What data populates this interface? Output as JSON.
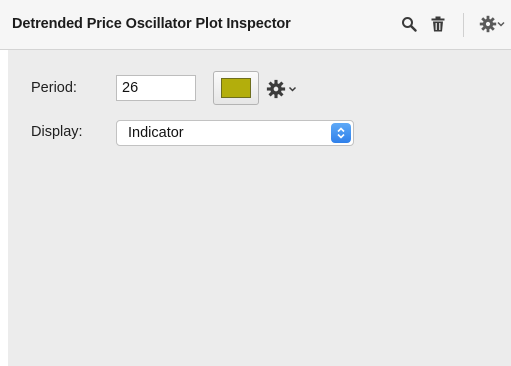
{
  "header": {
    "title": "Detrended Price Oscillator Plot Inspector",
    "icons": [
      "search-icon",
      "trash-icon",
      "gear-icon",
      "chevron-down-icon"
    ]
  },
  "fields": {
    "period_label": "Period:",
    "period_value": "26",
    "color_hex": "#b3ae0c",
    "display_label": "Display:",
    "display_value": "Indicator"
  }
}
